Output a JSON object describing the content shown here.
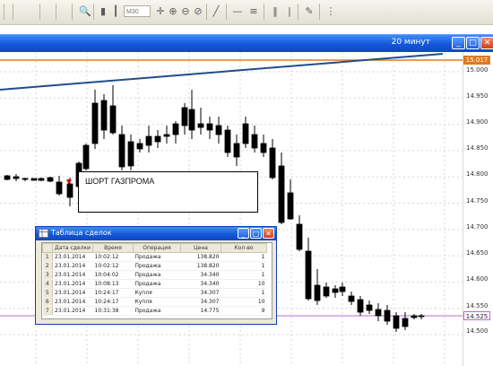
{
  "toolbar": {
    "zoom_value": "M30"
  },
  "window": {
    "title": "20 минут",
    "minimize": "_",
    "maximize": "□",
    "close": "✕"
  },
  "price_axis": {
    "labels": [
      "15.000",
      "14.950",
      "14.900",
      "14.850",
      "14.800",
      "14.750",
      "14.700",
      "14.650",
      "14.600",
      "14.550",
      "14.500"
    ],
    "current_price": "14.525",
    "top_marker": "15.017"
  },
  "annotation": {
    "text": "ШОРТ ГАЗПРОМА"
  },
  "colors": {
    "title_bar": "#1456d8",
    "trendline": "#1f4e8c",
    "resistance_line": "#e07a1f",
    "current_price_line": "#b86bd6"
  },
  "trades_window": {
    "title": "Таблица сделок",
    "columns": [
      "",
      "Дата сделки",
      "Время",
      "Операция",
      "Цена",
      "Кол-во"
    ],
    "rows": [
      {
        "n": "1",
        "date": "23.01.2014",
        "time": "10:02:12",
        "op": "Продажа",
        "price": "138.820",
        "qty": "1"
      },
      {
        "n": "2",
        "date": "23.01.2014",
        "time": "10:02:12",
        "op": "Продажа",
        "price": "138.820",
        "qty": "1"
      },
      {
        "n": "3",
        "date": "23.01.2014",
        "time": "10:04:02",
        "op": "Продажа",
        "price": "34.340",
        "qty": "1"
      },
      {
        "n": "4",
        "date": "23.01.2014",
        "time": "10:08:13",
        "op": "Продажа",
        "price": "34.340",
        "qty": "10"
      },
      {
        "n": "5",
        "date": "23.01.2014",
        "time": "10:24:17",
        "op": "Купля",
        "price": "34.307",
        "qty": "1"
      },
      {
        "n": "6",
        "date": "23.01.2014",
        "time": "10:24:17",
        "op": "Купля",
        "price": "34.307",
        "qty": "10"
      },
      {
        "n": "7",
        "date": "23.01.2014",
        "time": "10:31:38",
        "op": "Продажа",
        "price": "14.775",
        "qty": "9"
      }
    ]
  }
}
